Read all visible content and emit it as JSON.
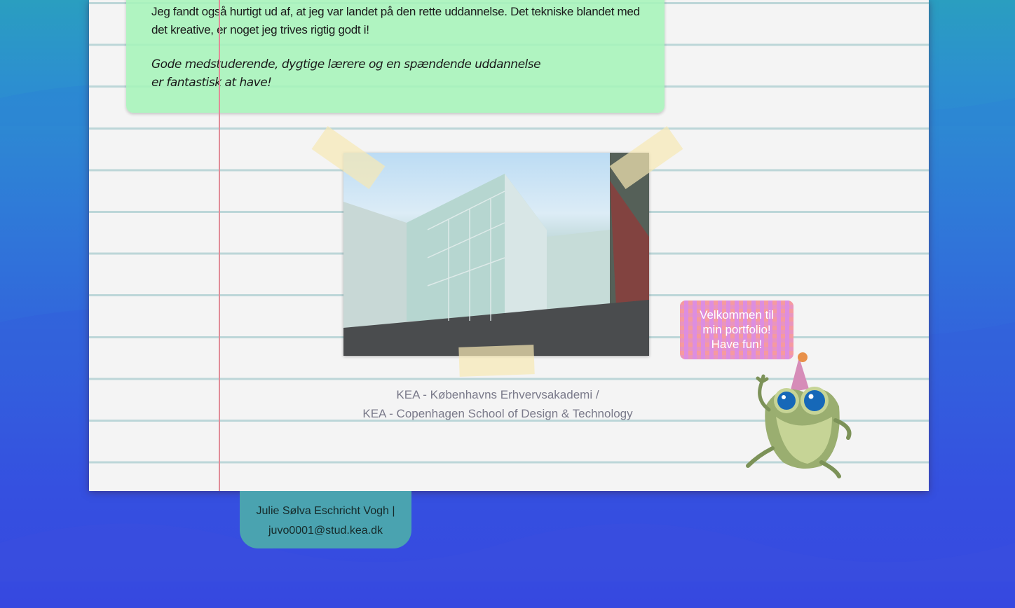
{
  "intro_box": {
    "paragraph": "Jeg fandt også hurtigt ud af, at jeg var landet på den rette uddannelse. Det tekniske blandet med det kreative, er noget jeg trives rigtig godt i!",
    "quote_line1": "Gode medstuderende, dygtige lærere og en spændende uddannelse",
    "quote_line2": "er fantastisk at have!"
  },
  "photo": {
    "caption_line1": "KEA - Københavns Erhvervsakademi /",
    "caption_line2": "KEA - Copenhagen School of Design & Technology"
  },
  "speech_bubble": {
    "line1": "Velkommen til",
    "line2": "min portfolio!",
    "line3": "Have fun!"
  },
  "footer": {
    "name": "Julie Sølva Eschricht Vogh |",
    "email": "juvo0001@stud.kea.dk"
  },
  "colors": {
    "green_box": "#a6f4b9",
    "margin_line": "#e08c98",
    "footer": "#4aa3b0",
    "page": "#f4f4f4"
  }
}
